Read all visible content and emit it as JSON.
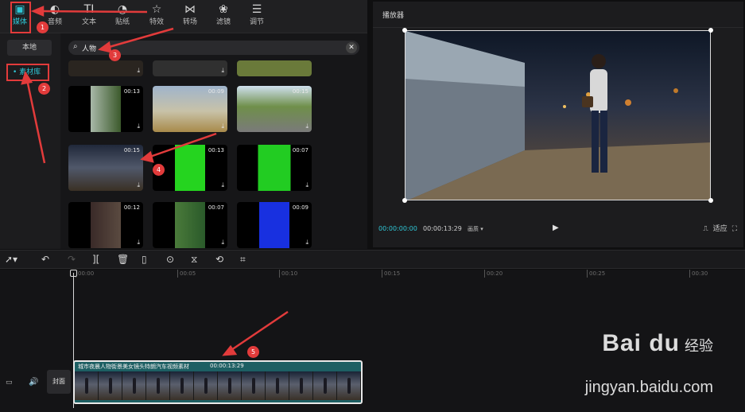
{
  "tabs": [
    {
      "label": "媒体",
      "icon": "media-icon"
    },
    {
      "label": "音频",
      "icon": "audio-icon"
    },
    {
      "label": "文本",
      "icon": "text-icon"
    },
    {
      "label": "贴纸",
      "icon": "sticker-icon"
    },
    {
      "label": "特效",
      "icon": "effects-icon"
    },
    {
      "label": "转场",
      "icon": "transition-icon"
    },
    {
      "label": "滤镜",
      "icon": "filter-icon"
    },
    {
      "label": "调节",
      "icon": "adjust-icon"
    }
  ],
  "sidebar": {
    "local_label": "本地",
    "library_label": "• 素材库"
  },
  "search": {
    "value": "人物"
  },
  "media": [
    {
      "duration": "00:13"
    },
    {
      "duration": "00:09"
    },
    {
      "duration": "00:15"
    },
    {
      "duration": "00:15"
    },
    {
      "duration": "00:13"
    },
    {
      "duration": "00:07"
    },
    {
      "duration": "00:12"
    },
    {
      "duration": "00:07"
    },
    {
      "duration": "00:09"
    }
  ],
  "player": {
    "title": "播放器",
    "current_time": "00:00:00:00",
    "total_time": "00:00:13:29",
    "quality": "画质 ▾",
    "fit_label": "适应"
  },
  "timeline": {
    "ruler": [
      "00:00",
      "00:05",
      "00:10",
      "00:15",
      "00:20",
      "00:25",
      "00:30"
    ],
    "cover_label": "封面",
    "clip_name": "城市夜晨人物街景美女镜头特朗汽车视频素材",
    "clip_duration": "00:00:13:29"
  },
  "annotations": [
    "1",
    "2",
    "3",
    "4",
    "5"
  ],
  "watermark": {
    "logo": "Bai du",
    "sub": "经验",
    "url": "jingyan.baidu.com"
  }
}
